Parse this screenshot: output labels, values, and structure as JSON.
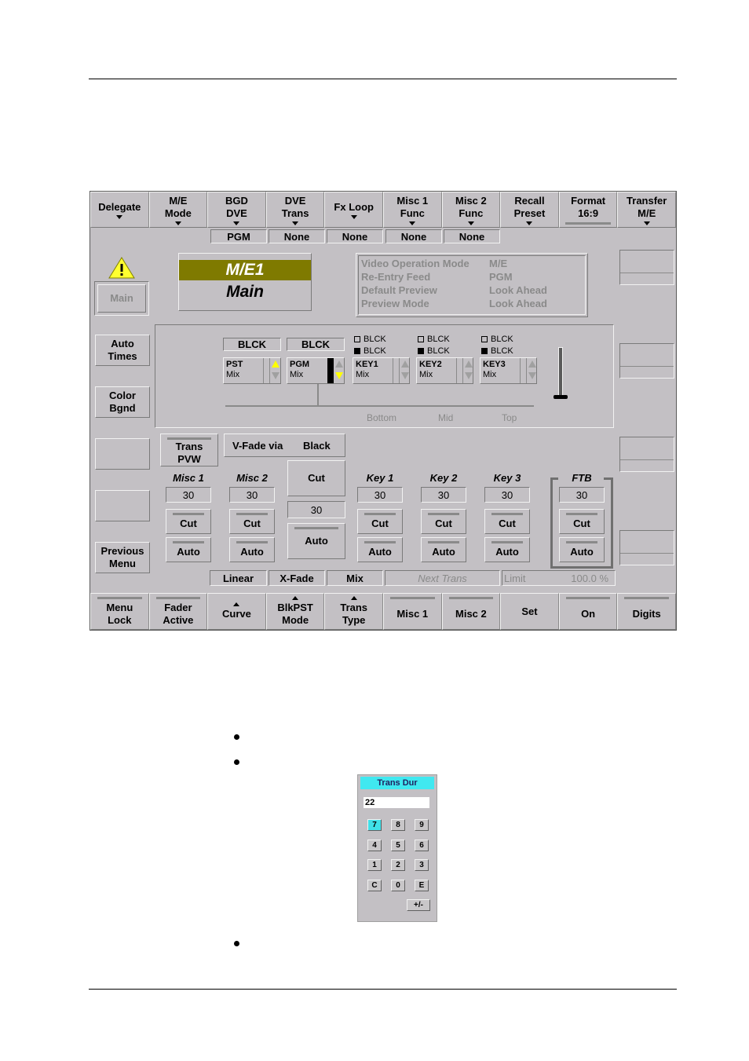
{
  "panel": {
    "top_buttons": [
      {
        "label1": "Delegate",
        "label2": "",
        "indicator": "dropdown"
      },
      {
        "label1": "M/E",
        "label2": "Mode",
        "indicator": "dropdown"
      },
      {
        "label1": "BGD",
        "label2": "DVE",
        "indicator": "dropdown"
      },
      {
        "label1": "DVE",
        "label2": "Trans",
        "indicator": "dropdown"
      },
      {
        "label1": "Fx Loop",
        "label2": "",
        "indicator": "dropdown"
      },
      {
        "label1": "Misc 1",
        "label2": "Func",
        "indicator": "dropdown"
      },
      {
        "label1": "Misc 2",
        "label2": "Func",
        "indicator": "dropdown"
      },
      {
        "label1": "Recall",
        "label2": "Preset",
        "indicator": "dropdown"
      },
      {
        "label1": "Format",
        "label2": "16:9",
        "indicator": "bar"
      },
      {
        "label1": "Transfer",
        "label2": "M/E",
        "indicator": "dropdown"
      }
    ],
    "top_values": [
      "PGM",
      "None",
      "None",
      "None",
      "None"
    ],
    "warning_icon": "warning-triangle-icon",
    "left_buttons": {
      "main": "Main",
      "auto_times": [
        "Auto",
        "Times"
      ],
      "color_bgnd": [
        "Color",
        "Bgnd"
      ],
      "previous_menu": [
        "Previous",
        "Menu"
      ]
    },
    "me_title": {
      "name": "M/E1",
      "sub": "Main",
      "accent": "#7f7a00"
    },
    "info": {
      "rows": [
        {
          "label": "Video Operation Mode",
          "value": "M/E"
        },
        {
          "label": "Re-Entry Feed",
          "value": "PGM"
        },
        {
          "label": "Default Preview",
          "value": "Look Ahead"
        },
        {
          "label": "Preview Mode",
          "value": "Look Ahead"
        }
      ]
    },
    "buses": {
      "pst_source": "BLCK",
      "pgm_source": "BLCK",
      "pst": {
        "name": "PST",
        "mode": "Mix"
      },
      "pgm": {
        "name": "PGM",
        "mode": "Mix"
      },
      "keys": [
        {
          "name": "KEY1",
          "mode": "Mix",
          "fill": "BLCK",
          "cut": "BLCK"
        },
        {
          "name": "KEY2",
          "mode": "Mix",
          "fill": "BLCK",
          "cut": "BLCK"
        },
        {
          "name": "KEY3",
          "mode": "Mix",
          "fill": "BLCK",
          "cut": "BLCK"
        }
      ],
      "layer_labels": [
        "Bottom",
        "Mid",
        "Top"
      ],
      "arrow_active_color": "#ffff00"
    },
    "trans_pvw": [
      "Trans",
      "PVW"
    ],
    "vfade": {
      "label": "V-Fade via",
      "value": "Black"
    },
    "main_cut": "Cut",
    "main_rate": "30",
    "main_auto": "Auto",
    "groups": [
      {
        "title": "Misc 1",
        "rate": "30",
        "cut": "Cut",
        "auto": "Auto"
      },
      {
        "title": "Misc 2",
        "rate": "30",
        "cut": "Cut",
        "auto": "Auto"
      },
      {
        "title": "Key 1",
        "rate": "30",
        "cut": "Cut",
        "auto": "Auto"
      },
      {
        "title": "Key 2",
        "rate": "30",
        "cut": "Cut",
        "auto": "Auto"
      },
      {
        "title": "Key 3",
        "rate": "30",
        "cut": "Cut",
        "auto": "Auto"
      },
      {
        "title": "FTB",
        "rate": "30",
        "cut": "Cut",
        "auto": "Auto"
      }
    ],
    "status": {
      "curve": "Linear",
      "blkpst": "X-Fade",
      "trans_type": "Mix",
      "next_trans": "Next Trans",
      "limit_label": "Limit",
      "limit_value": "100.0 %"
    },
    "bottom_buttons": [
      {
        "label1": "Menu",
        "label2": "Lock",
        "indicator": "bar"
      },
      {
        "label1": "Fader",
        "label2": "Active",
        "indicator": "bar"
      },
      {
        "label1": "Curve",
        "label2": "",
        "indicator": "up"
      },
      {
        "label1": "BlkPST",
        "label2": "Mode",
        "indicator": "up"
      },
      {
        "label1": "Trans",
        "label2": "Type",
        "indicator": "up"
      },
      {
        "label1": "Misc 1",
        "label2": "",
        "indicator": "bar"
      },
      {
        "label1": "Misc 2",
        "label2": "",
        "indicator": "bar"
      },
      {
        "label1": "Set",
        "label2": "",
        "indicator": "none"
      },
      {
        "label1": "On",
        "label2": "",
        "indicator": "bar"
      },
      {
        "label1": "Digits",
        "label2": "",
        "indicator": "bar"
      }
    ]
  },
  "keypad": {
    "title": "Trans Dur",
    "value": "22",
    "title_color": "#40e8f0",
    "keys": [
      "7",
      "8",
      "9",
      "4",
      "5",
      "6",
      "1",
      "2",
      "3",
      "C",
      "0",
      "E"
    ],
    "active_key": "7",
    "sign_key": "+/-"
  }
}
